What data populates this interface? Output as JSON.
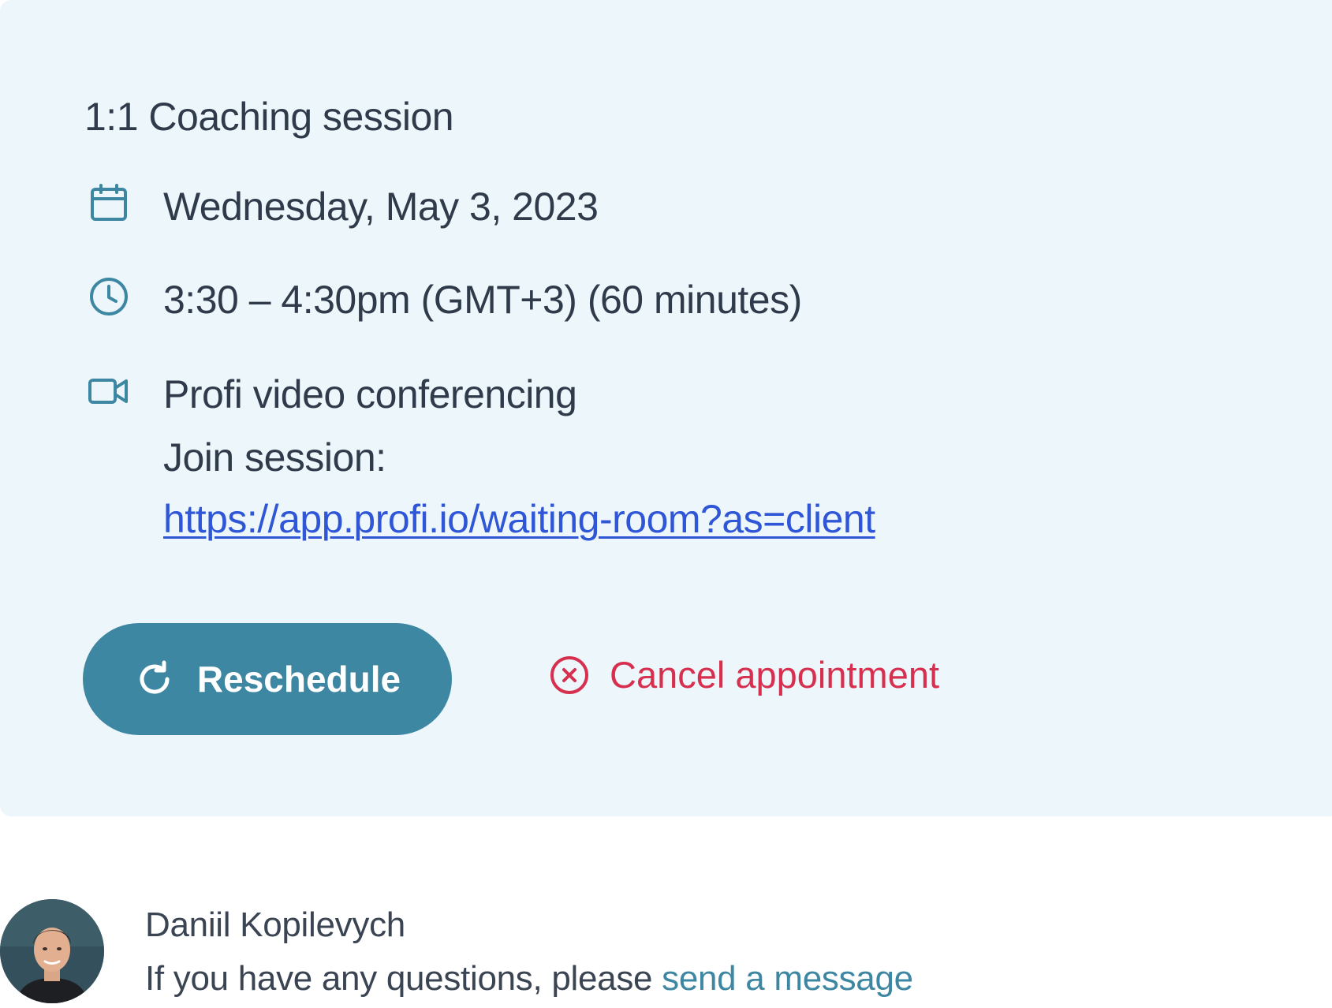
{
  "session": {
    "title": "1:1 Coaching session",
    "date": "Wednesday, May 3, 2023",
    "time": "3:30 – 4:30pm (GMT+3) (60 minutes)",
    "location": "Profi video conferencing",
    "join_label": "Join session:",
    "join_url": "https://app.profi.io/waiting-room?as=client"
  },
  "actions": {
    "reschedule_label": "Reschedule",
    "cancel_label": "Cancel appointment"
  },
  "footer": {
    "name": "Daniil Kopilevych",
    "message_prefix": "If you have any questions, please ",
    "message_link": "send a message"
  },
  "icons": {
    "date": "calendar-icon",
    "time": "clock-icon",
    "location": "video-camera-icon",
    "reschedule": "refresh-icon",
    "cancel": "close-circle-icon"
  },
  "colors": {
    "card_background": "#edf6fa",
    "icon_teal": "#3d87a3",
    "primary_button": "#3d87a3",
    "link_blue": "#2f56d6",
    "danger": "#d7304f",
    "text": "#2f3b4a"
  }
}
